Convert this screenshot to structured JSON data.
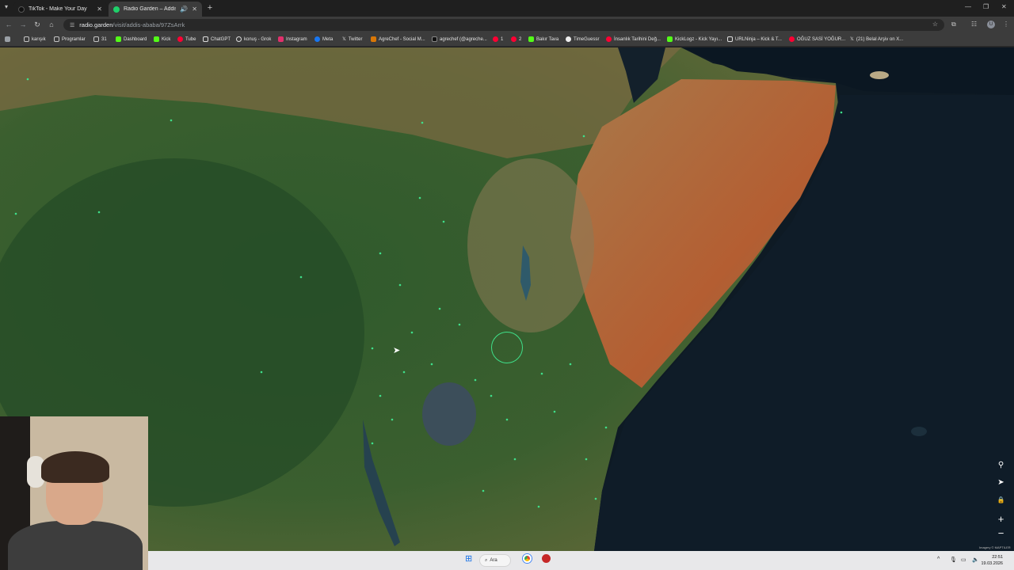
{
  "tabs": [
    {
      "title": "TikTok - Make Your Day",
      "favicon_color": "#111111"
    },
    {
      "title": "Radio Garden – Addis Ababa",
      "favicon_color": "#1fd06a"
    }
  ],
  "address_bar": {
    "host": "radio.garden",
    "path": "/visit/addis-ababa/97ZsArrk"
  },
  "bookmarks": [
    {
      "label": "karışık",
      "color": "#9aa0a6"
    },
    {
      "label": "Programlar",
      "color": "#9aa0a6"
    },
    {
      "label": "31",
      "color": "#9aa0a6"
    },
    {
      "label": "Dashboard",
      "color": "#53fc18"
    },
    {
      "label": "Kick",
      "color": "#53fc18"
    },
    {
      "label": "Tube",
      "color": "#ff0033"
    },
    {
      "label": "ChatGPT",
      "color": "#dddddd"
    },
    {
      "label": "konuş - Grok",
      "color": "#dddddd"
    },
    {
      "label": "Instagram",
      "color": "#e1306c"
    },
    {
      "label": "Meta",
      "color": "#1877f2"
    },
    {
      "label": "Twitter",
      "color": "#dddddd"
    },
    {
      "label": "AgreChef - Social M...",
      "color": "#d97706"
    },
    {
      "label": "agrechef (@agreche...",
      "color": "#dddddd"
    },
    {
      "label": "1",
      "color": "#ff0033"
    },
    {
      "label": "2",
      "color": "#ff0033"
    },
    {
      "label": "Bakır Tava",
      "color": "#53fc18"
    },
    {
      "label": "TimeGuessr",
      "color": "#eeeeee"
    },
    {
      "label": "İnsanlık Tarihini Değ...",
      "color": "#ff0033"
    },
    {
      "label": "KickLogz - Kick Yayı...",
      "color": "#53fc18"
    },
    {
      "label": "URLNinja – Kick & T...",
      "color": "#dddddd"
    },
    {
      "label": "OĞUZ SASİ YOĞUR...",
      "color": "#ff0033"
    },
    {
      "label": "(21) Belal Arşiv on X...",
      "color": "#dddddd"
    }
  ],
  "map_controls": [
    {
      "icon": "location-pin-icon",
      "glyph": "⚲"
    },
    {
      "icon": "navigate-arrow-icon",
      "glyph": "➤"
    },
    {
      "icon": "lock-icon",
      "glyph": "🔒"
    },
    {
      "icon": "zoom-in-icon",
      "glyph": "+"
    },
    {
      "icon": "zoom-out-icon",
      "glyph": "−"
    }
  ],
  "map_attribution": "Imagery © MAPTILER",
  "taskbar": {
    "search_label": "Ara",
    "time": "22:51",
    "date": "19.03.2026"
  },
  "colors": {
    "station_accent": "#3fe08a",
    "ocean": "#0e1a24"
  }
}
